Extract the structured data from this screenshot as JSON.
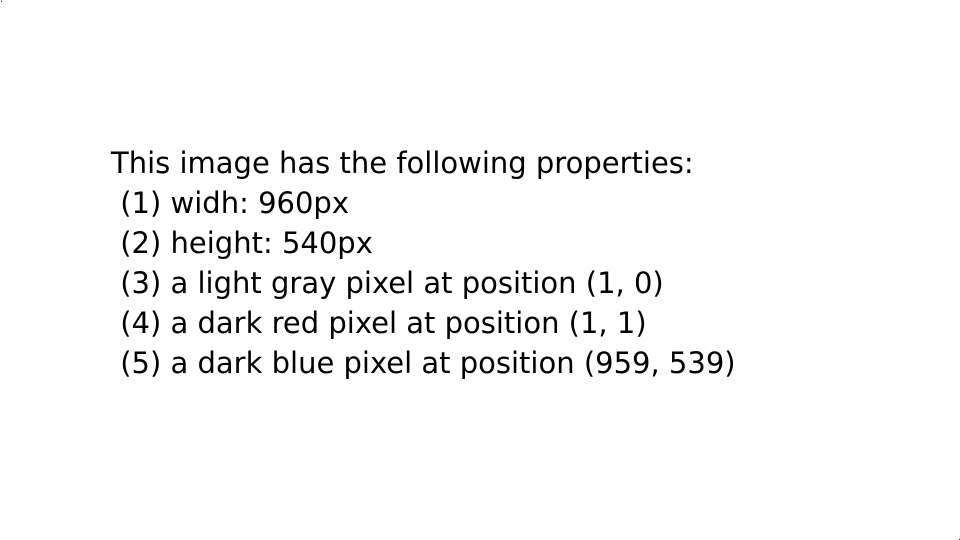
{
  "document": {
    "heading": "This image has the following properties:",
    "items": [
      " (1) widh: 960px",
      " (2) height: 540px",
      " (3) a light gray pixel at position (1, 0)",
      " (4) a dark red pixel at position (1, 1)",
      " (5) a dark blue pixel at position (959, 539)"
    ]
  },
  "marker_pixels": {
    "light_gray": "#d3d3d3",
    "dark_red": "#8b0000",
    "dark_blue": "#00008b"
  }
}
